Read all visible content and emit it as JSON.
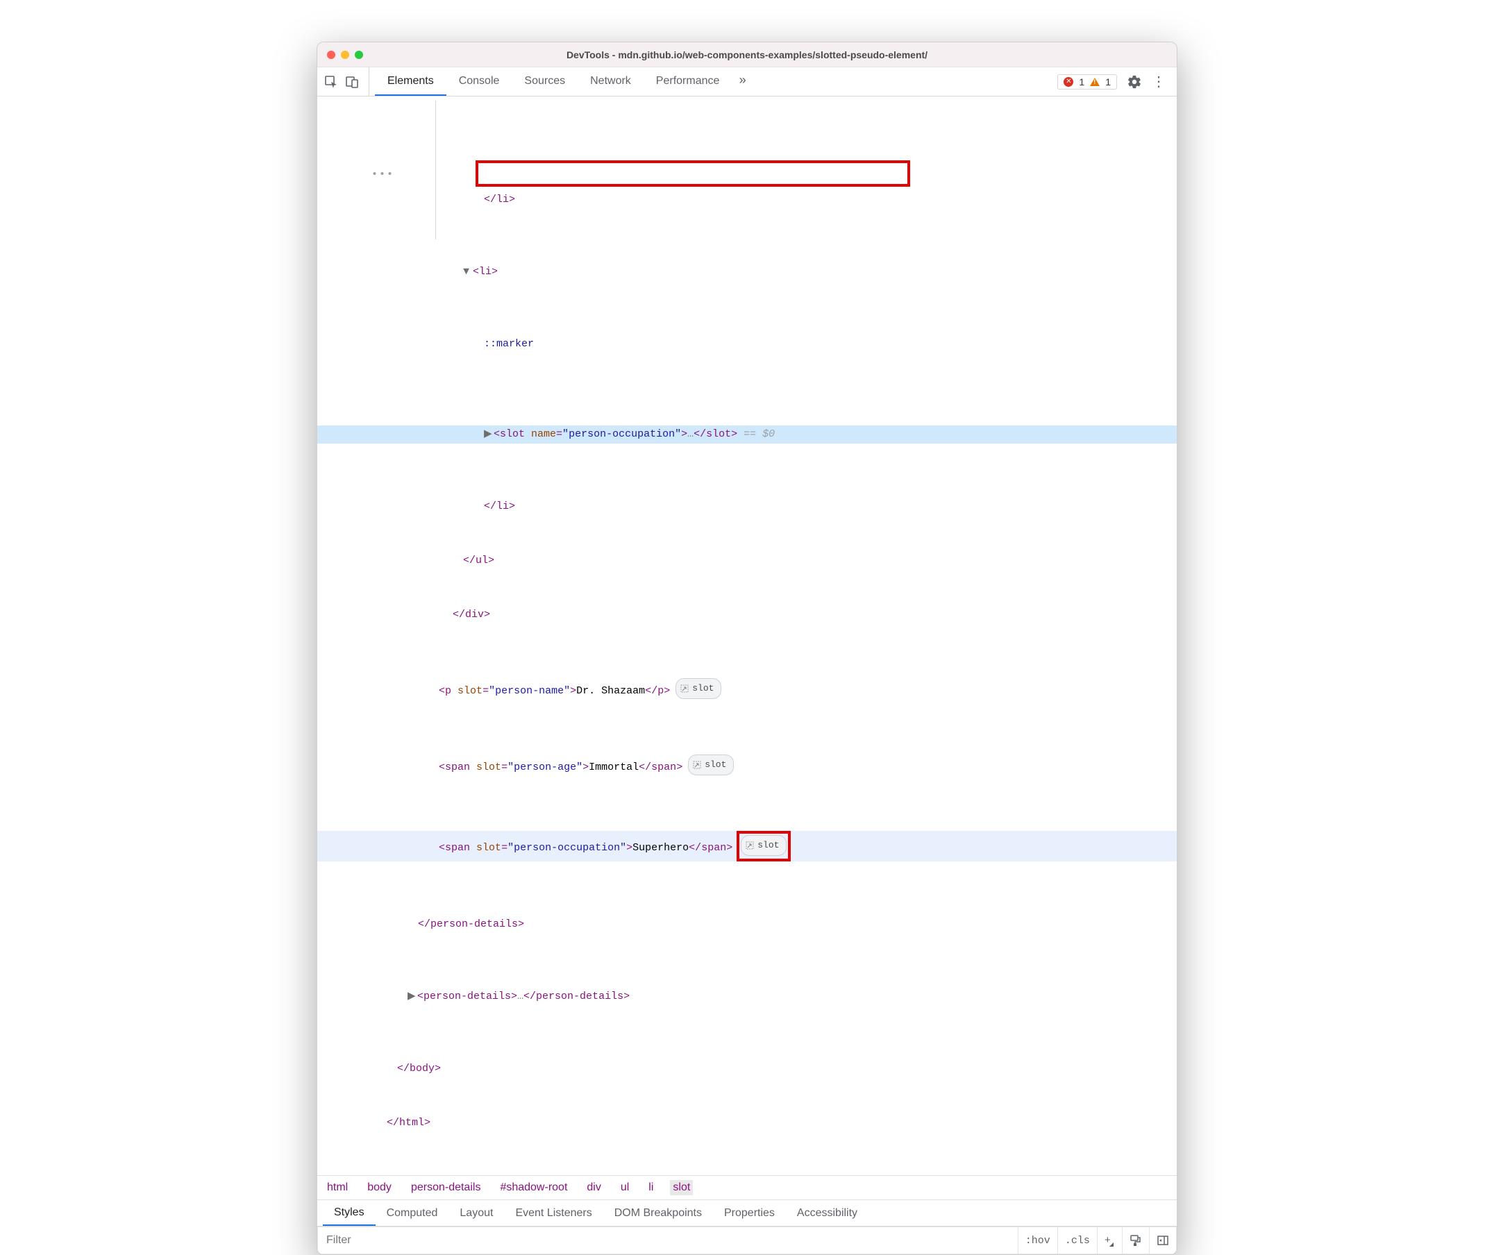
{
  "window": {
    "title": "DevTools - mdn.github.io/web-components-examples/slotted-pseudo-element/"
  },
  "toolbar": {
    "tabs": [
      "Elements",
      "Console",
      "Sources",
      "Network",
      "Performance"
    ],
    "active": "Elements",
    "more": "»",
    "errors": "1",
    "warnings": "1"
  },
  "tree": {
    "li_close": "</li>",
    "li_open": "<li>",
    "marker": "::marker",
    "slot_open": "<slot ",
    "slot_attr_name": "name",
    "slot_attr_eq": "=",
    "slot_attr_q": "\"",
    "slot_attr_val": "person-occupation",
    "slot_gt": ">",
    "ellipsis": "…",
    "slot_close": "</slot>",
    "eq0": " == $0",
    "li_close2": "</li>",
    "ul_close": "</ul>",
    "div_close": "</div>",
    "p_tag": "p",
    "span_tag": "span",
    "slot_attr": "slot",
    "slot1_val": "person-name",
    "slot1_text": "Dr. Shazaam",
    "slot2_val": "person-age",
    "slot2_text": "Immortal",
    "slot3_val": "person-occupation",
    "slot3_text": "Superhero",
    "pd_close": "</person-details>",
    "pd_open": "<person-details>",
    "body_close": "</body>",
    "html_close": "</html>",
    "dots": "…",
    "badge": "slot"
  },
  "crumb": [
    "html",
    "body",
    "person-details",
    "#shadow-root",
    "div",
    "ul",
    "li",
    "slot"
  ],
  "subtabs": [
    "Styles",
    "Computed",
    "Layout",
    "Event Listeners",
    "DOM Breakpoints",
    "Properties",
    "Accessibility"
  ],
  "subtabs_active": "Styles",
  "filter": {
    "placeholder": "Filter",
    "hov": ":hov",
    "cls": ".cls",
    "plus": "+"
  }
}
